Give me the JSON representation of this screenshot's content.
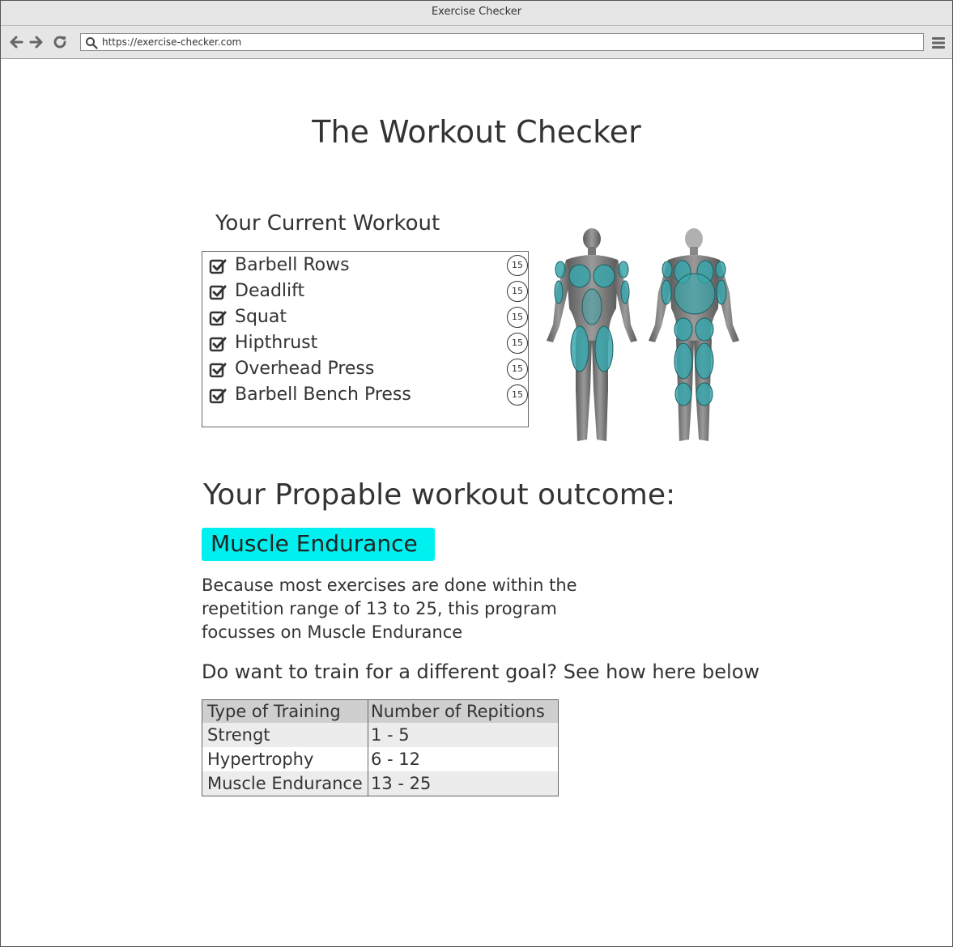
{
  "window": {
    "title": "Exercise Checker"
  },
  "browser": {
    "url": "https://exercise-checker.com",
    "back_icon": "arrow-left-icon",
    "forward_icon": "arrow-right-icon",
    "reload_icon": "reload-icon",
    "menu_icon": "hamburger-menu-icon"
  },
  "page": {
    "title": "The Workout Checker"
  },
  "workout": {
    "heading": "Your Current Workout",
    "exercises": [
      {
        "name": "Barbell Rows",
        "reps": "15",
        "checked": true
      },
      {
        "name": "Deadlift",
        "reps": "15",
        "checked": true
      },
      {
        "name": "Squat",
        "reps": "15",
        "checked": true
      },
      {
        "name": "Hipthrust",
        "reps": "15",
        "checked": true
      },
      {
        "name": "Overhead Press",
        "reps": "15",
        "checked": true
      },
      {
        "name": "Barbell Bench Press",
        "reps": "15",
        "checked": true
      }
    ]
  },
  "outcome": {
    "heading": "Your Propable workout outcome:",
    "result": "Muscle Endurance",
    "result_color": "#00f0f0",
    "explanation": "Because most exercises are done within the repetition range of 13 to 25, this program focusses on Muscle Endurance",
    "question": "Do want to train for a different goal? See how here below"
  },
  "training_table": {
    "headers": [
      "Type of Training",
      "Number of Repitions"
    ],
    "rows": [
      [
        "Strengt",
        "1 - 5"
      ],
      [
        "Hypertrophy",
        "6 - 12"
      ],
      [
        "Muscle Endurance",
        "13 - 25"
      ]
    ]
  },
  "colors": {
    "highlight": "#00f0f0",
    "muscle": "#3aa6aa"
  }
}
